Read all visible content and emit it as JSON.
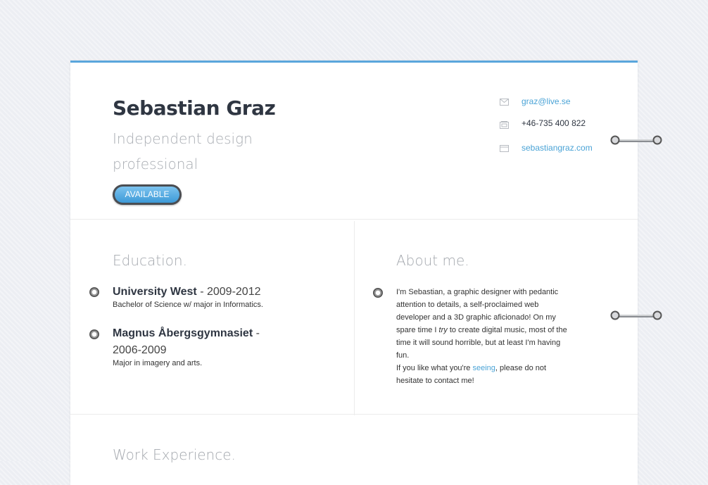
{
  "header": {
    "name": "Sebastian Graz",
    "tagline": "Independent design professional",
    "status_badge": "AVAILABLE"
  },
  "contact": {
    "email": "graz@live.se",
    "phone": "+46-735 400 822",
    "website": "sebastiangraz.com"
  },
  "education": {
    "title": "Education.",
    "items": [
      {
        "school": "University West",
        "years": " - 2009-2012",
        "detail": "Bachelor of Science w/ major in Informatics."
      },
      {
        "school": "Magnus Åbergsgymnasiet",
        "years": " - 2006-2009",
        "detail": "Major in imagery and arts."
      }
    ]
  },
  "about": {
    "title": "About me.",
    "text_1": "I'm Sebastian, a graphic designer with pedantic attention to details, a self-proclaimed web developer and a 3D graphic aficionado! On my spare time I ",
    "text_em": "try",
    "text_2": " to create digital music, most of the time it will sound horrible, but at least I'm having fun.",
    "text_3": "If you like what you're ",
    "link": "seeing",
    "text_4": ", please do not hesitate to contact me!"
  },
  "work": {
    "title": "Work Experience."
  },
  "colors": {
    "accent": "#5aa6dc",
    "link": "#4aa3d6",
    "heading": "#2f3642",
    "muted": "#a4a8ae"
  }
}
